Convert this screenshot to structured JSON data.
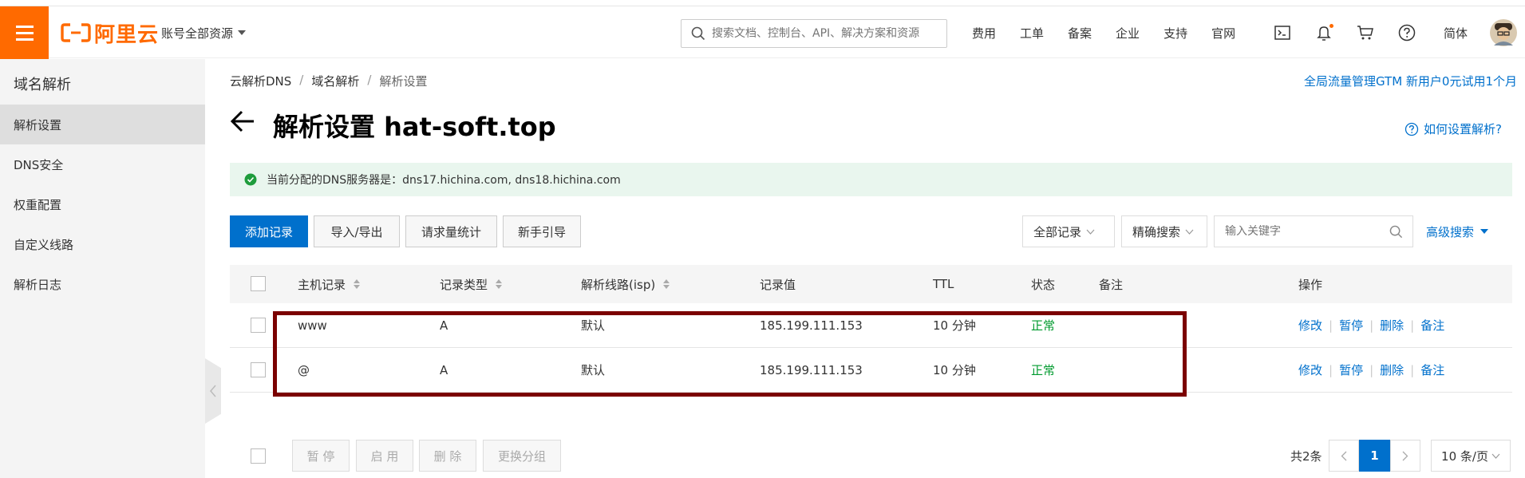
{
  "topbar": {
    "logo_text": "阿里云",
    "account_label": "账号全部资源",
    "search_placeholder": "搜索文档、控制台、API、解决方案和资源",
    "nav": [
      "费用",
      "工单",
      "备案",
      "企业",
      "支持",
      "官网"
    ],
    "lang": "简体",
    "brand_color": "#ff6a00"
  },
  "sidebar": {
    "title": "域名解析",
    "items": [
      {
        "label": "解析设置",
        "active": true
      },
      {
        "label": "DNS安全"
      },
      {
        "label": "权重配置"
      },
      {
        "label": "自定义线路"
      },
      {
        "label": "解析日志"
      }
    ]
  },
  "breadcrumb": {
    "items": [
      "云解析DNS",
      "域名解析",
      "解析设置"
    ],
    "separator": "/"
  },
  "promo_link": "全局流量管理GTM 新用户0元试用1个月",
  "page_title": "解析设置 hat-soft.top",
  "help_link": "如何设置解析?",
  "notice": "当前分配的DNS服务器是：dns17.hichina.com, dns18.hichina.com",
  "toolbar": {
    "add": "添加记录",
    "import_export": "导入/导出",
    "stats": "请求量统计",
    "guide": "新手引导",
    "filter_all": "全部记录",
    "exact_search": "精确搜索",
    "keyword_placeholder": "输入关键字",
    "advanced": "高级搜索"
  },
  "table": {
    "headers": {
      "host": "主机记录",
      "type": "记录类型",
      "line": "解析线路(isp)",
      "value": "记录值",
      "ttl": "TTL",
      "status": "状态",
      "remark": "备注",
      "ops": "操作"
    },
    "rows": [
      {
        "host": "www",
        "type": "A",
        "line": "默认",
        "value": "185.199.111.153",
        "ttl": "10 分钟",
        "status": "正常"
      },
      {
        "host": "@",
        "type": "A",
        "line": "默认",
        "value": "185.199.111.153",
        "ttl": "10 分钟",
        "status": "正常"
      }
    ],
    "row_ops": {
      "edit": "修改",
      "pause": "暂停",
      "delete": "删除",
      "remark": "备注"
    }
  },
  "footer": {
    "pause": "暂 停",
    "enable": "启 用",
    "delete": "删 除",
    "regroup": "更换分组",
    "total": "共2条",
    "current_page": "1",
    "page_size": "10 条/页"
  }
}
